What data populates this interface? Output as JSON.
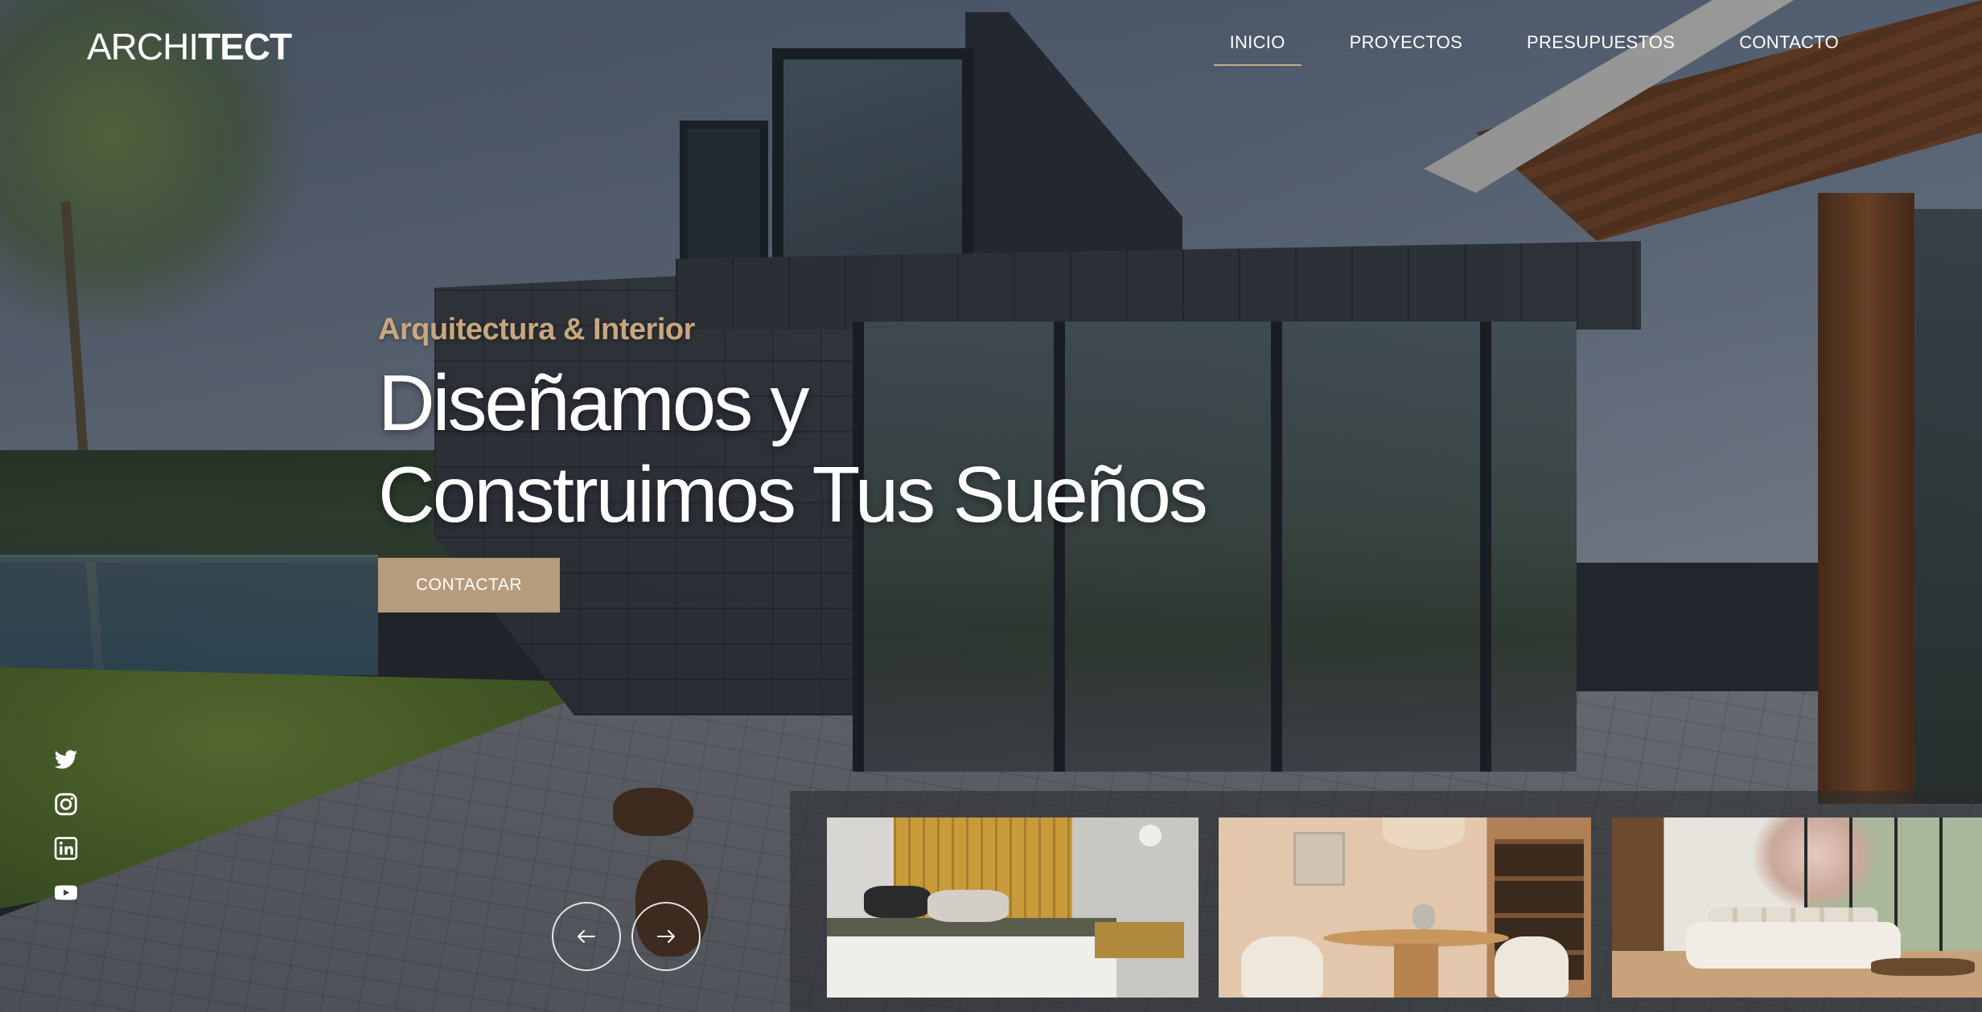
{
  "brand": {
    "logo_light": "ARCHI",
    "logo_bold": "TECT"
  },
  "nav": {
    "items": [
      {
        "label": "INICIO",
        "active": true
      },
      {
        "label": "PROYECTOS",
        "active": false
      },
      {
        "label": "PRESUPUESTOS",
        "active": false
      },
      {
        "label": "CONTACTO",
        "active": false
      }
    ]
  },
  "hero": {
    "kicker": "Arquitectura & Interior",
    "title_line1": "Diseñamos y",
    "title_line2": "Construimos Tus Sueños",
    "cta_label": "CONTACTAR"
  },
  "social": {
    "icons": [
      "twitter-icon",
      "instagram-icon",
      "linkedin-icon",
      "youtube-icon"
    ]
  },
  "slider": {
    "prev_icon": "arrow-left-icon",
    "next_icon": "arrow-right-icon",
    "thumbnails": [
      "bedroom-thumbnail",
      "dining-room-thumbnail",
      "living-room-thumbnail"
    ]
  },
  "colors": {
    "accent": "#c9a77e",
    "cta_background": "#b59c7d",
    "nav_underline": "#c7ad8c",
    "text": "#ffffff"
  }
}
